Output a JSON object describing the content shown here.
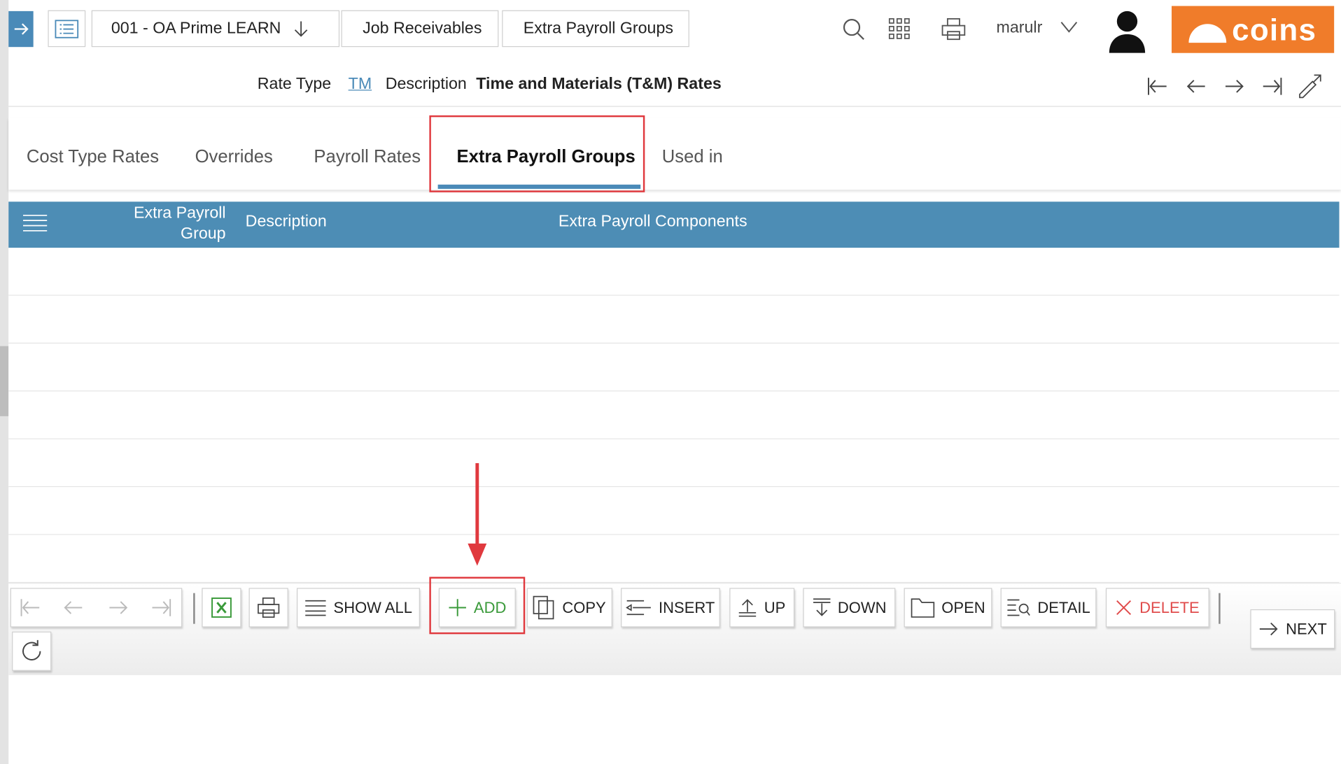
{
  "breadcrumb": {
    "company": "001 - OA Prime LEARN",
    "module": "Job Receivables",
    "page": "Extra Payroll Groups"
  },
  "user": {
    "name": "marulr"
  },
  "logo": {
    "text": "coins"
  },
  "header": {
    "rate_type_label": "Rate Type",
    "rate_type_value": "TM",
    "description_label": "Description",
    "description_value": "Time and Materials (T&M) Rates"
  },
  "tabs": [
    {
      "label": "Cost Type Rates"
    },
    {
      "label": "Overrides"
    },
    {
      "label": "Payroll Rates"
    },
    {
      "label": "Extra Payroll Groups",
      "active": true
    },
    {
      "label": "Used in"
    }
  ],
  "grid": {
    "columns": [
      "Extra Payroll Group",
      "Description",
      "Extra Payroll Components"
    ],
    "rows": []
  },
  "toolbar": {
    "show_all": "SHOW ALL",
    "add": "ADD",
    "copy": "COPY",
    "insert": "INSERT",
    "up": "UP",
    "down": "DOWN",
    "open": "OPEN",
    "detail": "DETAIL",
    "delete": "DELETE",
    "next": "NEXT"
  },
  "colors": {
    "accent": "#4a8ab8",
    "grid_header": "#4d8db5",
    "brand": "#f07c2a",
    "highlight": "#e0393e",
    "add": "#3a9a3a",
    "delete": "#e04b4b"
  }
}
